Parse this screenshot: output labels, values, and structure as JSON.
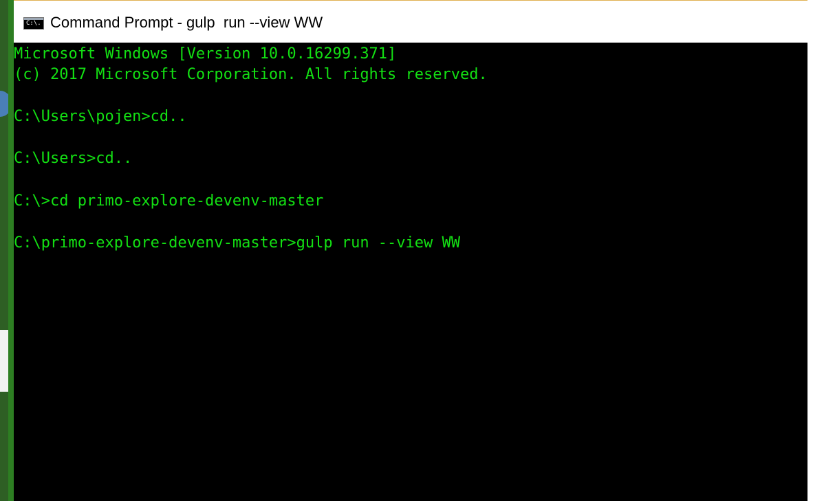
{
  "window": {
    "title": "Command Prompt - gulp  run --view WW",
    "icon_label": "C:\\.",
    "icon_name": "cmd-icon"
  },
  "console": {
    "text_color": "#13e013",
    "background": "#000000",
    "lines": [
      "Microsoft Windows [Version 10.0.16299.371]",
      "(c) 2017 Microsoft Corporation. All rights reserved.",
      "",
      "C:\\Users\\pojen>cd..",
      "",
      "C:\\Users>cd..",
      "",
      "C:\\>cd primo-explore-devenv-master",
      "",
      "C:\\primo-explore-devenv-master>gulp run --view WW"
    ]
  }
}
